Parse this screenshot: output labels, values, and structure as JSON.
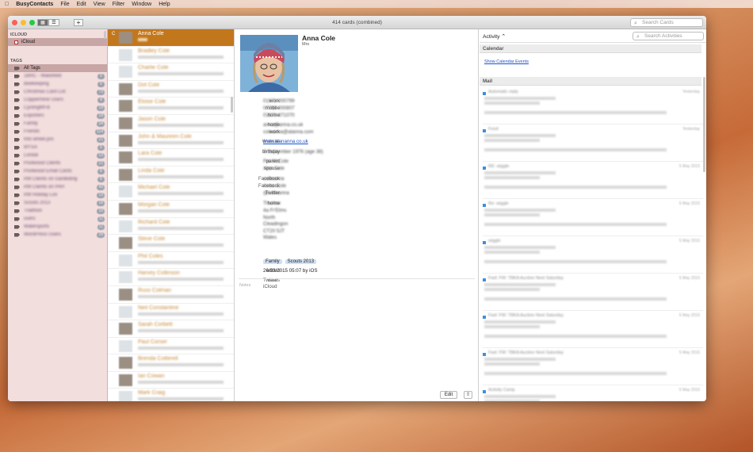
{
  "menubar": {
    "apple": "",
    "items": [
      "BusyContacts",
      "File",
      "Edit",
      "View",
      "Filter",
      "Window",
      "Help"
    ]
  },
  "window": {
    "title": "414 cards (combined)",
    "search_cards_placeholder": "Search Cards",
    "add_label": "+"
  },
  "sidebar": {
    "icloud_heading": "ICLOUD",
    "icloud_item": "iCloud",
    "tags_heading": "TAGS",
    "all_tags": "All Tags",
    "tags": [
      {
        "label": "1BRC - Wakefield",
        "count": "0"
      },
      {
        "label": "Beekeeping",
        "count": "0"
      },
      {
        "label": "Christmas Card List",
        "count": "73"
      },
      {
        "label": "Coppermine Users",
        "count": "4"
      },
      {
        "label": "CyclingWFB",
        "count": "19"
      },
      {
        "label": "Exporters",
        "count": "19"
      },
      {
        "label": "Family",
        "count": "24"
      },
      {
        "label": "Friends",
        "count": "114"
      },
      {
        "label": "Info wheel.pro",
        "count": "21"
      },
      {
        "label": "MYSA",
        "count": "5"
      },
      {
        "label": "Londal",
        "count": "13"
      },
      {
        "label": "Poolwood Clients",
        "count": "21"
      },
      {
        "label": "Poolwood Email Cards",
        "count": "6"
      },
      {
        "label": "RM Clients on Gardeding",
        "count": "6"
      },
      {
        "label": "RM Clients on PAH",
        "count": "43"
      },
      {
        "label": "RM Holiday List",
        "count": "13"
      },
      {
        "label": "Scouts 2013",
        "count": "16"
      },
      {
        "label": "Triathlon",
        "count": "10"
      },
      {
        "label": "users",
        "count": "11"
      },
      {
        "label": "Watersports",
        "count": "11"
      },
      {
        "label": "WordPress Users",
        "count": "29"
      }
    ]
  },
  "cards": [
    {
      "name": "Anna Cole",
      "selected": true,
      "letter": "C",
      "gray": false
    },
    {
      "name": "Bradley Cole",
      "gray": true
    },
    {
      "name": "Charlie Cole",
      "gray": true
    },
    {
      "name": "Dot Cole",
      "gray": false
    },
    {
      "name": "Eloise Cole",
      "gray": false
    },
    {
      "name": "Jason Cole",
      "gray": false
    },
    {
      "name": "John & Maureen Cole",
      "gray": false
    },
    {
      "name": "Lara Cole",
      "gray": false
    },
    {
      "name": "Linda Cole",
      "gray": false
    },
    {
      "name": "Michael Cole",
      "gray": true
    },
    {
      "name": "Morgan Cole",
      "gray": false
    },
    {
      "name": "Richard Cole",
      "gray": true
    },
    {
      "name": "Steve Cole",
      "gray": false
    },
    {
      "name": "Phil Coles",
      "gray": true
    },
    {
      "name": "Harvey Collinson",
      "gray": true
    },
    {
      "name": "Russ Colman",
      "gray": false
    },
    {
      "name": "Neil Constantine",
      "gray": true
    },
    {
      "name": "Sarah Corbett",
      "gray": false
    },
    {
      "name": "Paul Corser",
      "gray": true
    },
    {
      "name": "Brenda Cotterell",
      "gray": false
    },
    {
      "name": "Ian Cowan",
      "gray": false
    },
    {
      "name": "Mark Craig",
      "gray": true
    }
  ],
  "detail": {
    "name": "Anna Cole",
    "title": "Mrs",
    "fields": [
      {
        "k": "work",
        "v": "01673 000799",
        "blur": true
      },
      {
        "k": "mobile",
        "v": "07780 000807",
        "blur": true
      },
      {
        "k": "home",
        "v": "01673 871070",
        "blur": true
      },
      {
        "k": "home",
        "v": "anna@anna.co.uk",
        "blur": true
      },
      {
        "k": "work",
        "v": "coleanna@alanna.com",
        "blur": true
      },
      {
        "k": "Website",
        "v": "www.alananna.co.uk",
        "link": true
      },
      {
        "k": "birthday",
        "v": "8 September 1976 (age 38)",
        "blur": true
      },
      {
        "k": "parent",
        "v": "Pat McCole",
        "blur": true
      },
      {
        "k": "spouse",
        "v": "Alan Cole",
        "blur": true
      },
      {
        "k": "Facebook",
        "v": "colleanna",
        "blur": true
      },
      {
        "k": "Facebook",
        "v": "Anna Cole",
        "blur": true
      },
      {
        "k": "Twitter",
        "v": "@colleanna",
        "blur": true
      },
      {
        "k": "home",
        "v": "Thurlow",
        "blur": true
      }
    ],
    "address_lines": [
      "4a Fr'Elms",
      "North",
      "Cleadingon",
      "CT20 5JT",
      "Wales"
    ],
    "tags_label": "tags",
    "tags": [
      "Family",
      "Scouts 2013"
    ],
    "edited_label": "edited",
    "edited_value": "26/03/2015 05:07 by iOS",
    "cards_label": "cards",
    "cards_values": [
      "Twitter",
      "iCloud"
    ],
    "notes_placeholder": "Notes",
    "edit_button": "Edit"
  },
  "activity": {
    "dropdown_label": "Activity ⌃",
    "search_placeholder": "Search Activities",
    "calendar_heading": "Calendar",
    "show_calendar_events": "Show Calendar Events",
    "mail_heading": "Mail",
    "mails": [
      {
        "subject": "Automatic reply",
        "date": "Yesterday"
      },
      {
        "subject": "Food",
        "date": "Yesterday"
      },
      {
        "subject": "RE: wiggle",
        "date": "5 May 2015"
      },
      {
        "subject": "Re: wiggle",
        "date": "5 May 2015"
      },
      {
        "subject": "wiggle",
        "date": "5 May 2015"
      },
      {
        "subject": "Fwd: FW: TBKA Auction Next Saturday",
        "date": "5 May 2015"
      },
      {
        "subject": "Fwd: FW: TBKA Auction Next Saturday",
        "date": "5 May 2015"
      },
      {
        "subject": "Fwd: FW: TBKA Auction Next Saturday",
        "date": "5 May 2015"
      },
      {
        "subject": "Activity Camp",
        "date": "5 May 2015"
      }
    ]
  },
  "colors": {
    "selection_orange": "#c3771c",
    "sidebar_bg": "#f3dede",
    "link_blue": "#1a53c9",
    "mail_dot": "#3f8fd9"
  }
}
